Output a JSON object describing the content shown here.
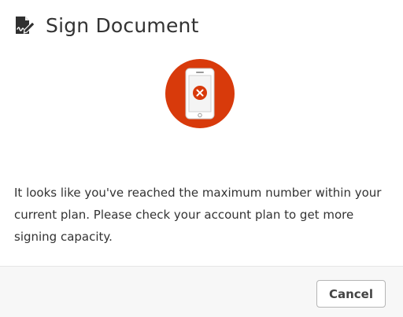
{
  "dialog": {
    "title": "Sign Document",
    "title_icon": "sign-document-icon",
    "status_icon": "phone-error-icon",
    "message": "It looks like you've reached the maximum number within your current plan. Please check your account plan to get more signing capacity.",
    "cancel_label": "Cancel"
  },
  "colors": {
    "accent": "#d83a0b",
    "text": "#333333",
    "footer_bg": "#f7f7f7"
  }
}
